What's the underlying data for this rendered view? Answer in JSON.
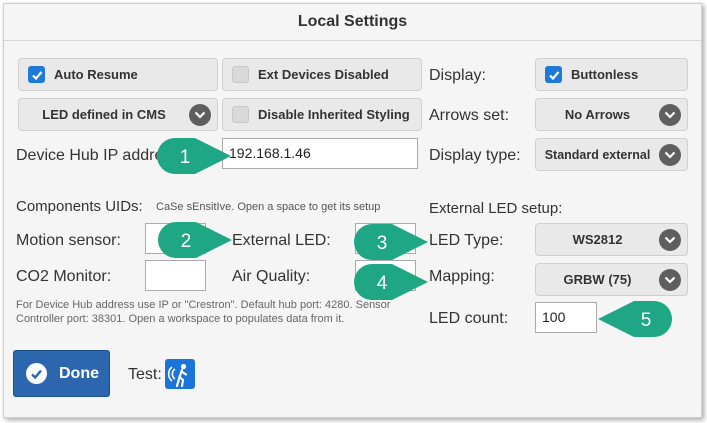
{
  "header": {
    "title": "Local Settings"
  },
  "buttons": {
    "auto_resume": "Auto Resume",
    "ext_devices_disabled": "Ext Devices Disabled",
    "buttonless": "Buttonless",
    "led_defined": "LED defined in CMS",
    "disable_inherited": "Disable Inherited Styling",
    "no_arrows": "No Arrows",
    "standard_external": "Standard external",
    "ws2812": "WS2812",
    "grbw": "GRBW (75)"
  },
  "labels": {
    "display": "Display:",
    "arrows_set": "Arrows set:",
    "device_hub_ip": "Device Hub IP addre",
    "display_type": "Display type:",
    "components_uids": "Components UIDs:",
    "components_hint": "CaSe sEnsitIve. Open a space to get its setup",
    "external_led_setup": "External LED setup:",
    "motion_sensor": "Motion sensor:",
    "external_led": "External LED:",
    "led_type": "LED Type:",
    "co2_monitor": "CO2 Monitor:",
    "air_quality": "Air Quality:",
    "mapping": "Mapping:",
    "led_count": "LED count:",
    "test": "Test:"
  },
  "inputs": {
    "device_hub_ip": "192.168.1.46",
    "led_count": "100"
  },
  "note": {
    "line1": "For Device Hub address use IP or \"Crestron\". Default hub port: 4280. Sensor",
    "line2": "Controller port: 38301. Open a workspace to populates data from it."
  },
  "done": {
    "label": "Done"
  },
  "callouts": [
    "1",
    "2",
    "3",
    "4",
    "5"
  ],
  "colors": {
    "accent": "#1e7ad8",
    "callout": "#1fa684",
    "done": "#2b66ae"
  }
}
